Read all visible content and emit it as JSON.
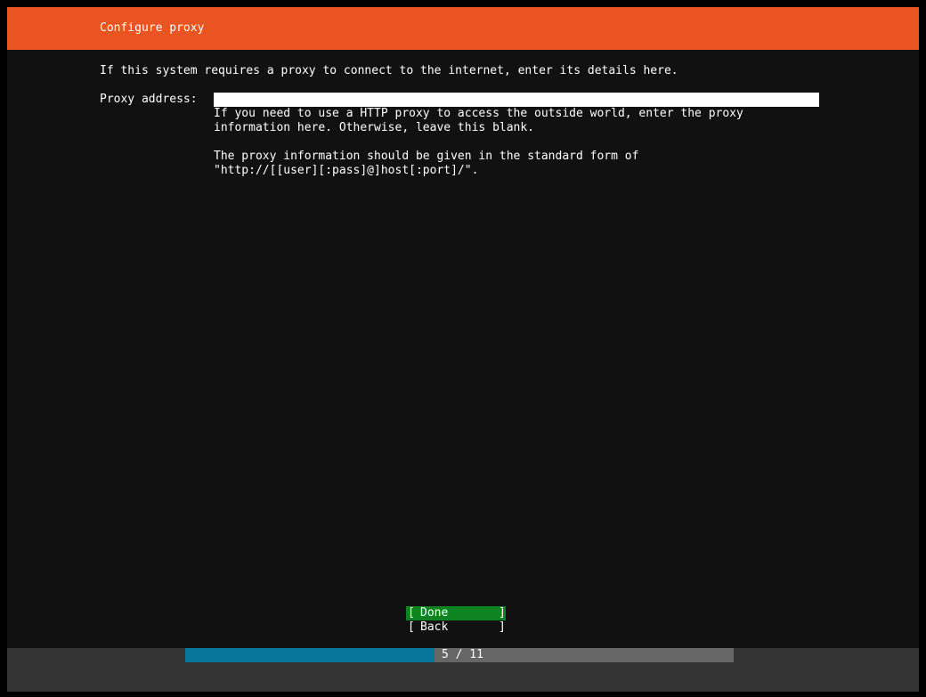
{
  "header": {
    "title": "Configure proxy"
  },
  "intro": "If this system requires a proxy to connect to the internet, enter its details here.",
  "proxy_field": {
    "label": "Proxy address:",
    "value": "",
    "help_lines": [
      "If you need to use a HTTP proxy to access the outside world, enter the proxy",
      "information here. Otherwise, leave this blank.",
      "",
      "The proxy information should be given in the standard form of",
      "\"http://[[user][:pass]@]host[:port]/\"."
    ]
  },
  "buttons": {
    "done": {
      "open": "[",
      "label": "Done",
      "close": "]"
    },
    "back": {
      "open": "[",
      "label": "Back",
      "close": "]"
    }
  },
  "progress": {
    "current": 5,
    "total": 11,
    "text": "5 / 11",
    "fraction": 0.4545
  },
  "colors": {
    "header_bg": "#e95420",
    "screen_bg": "#111111",
    "done_bg": "#0e8420",
    "progress_fill": "#06779a",
    "progress_track": "#666666",
    "footer_bg": "#333333"
  }
}
